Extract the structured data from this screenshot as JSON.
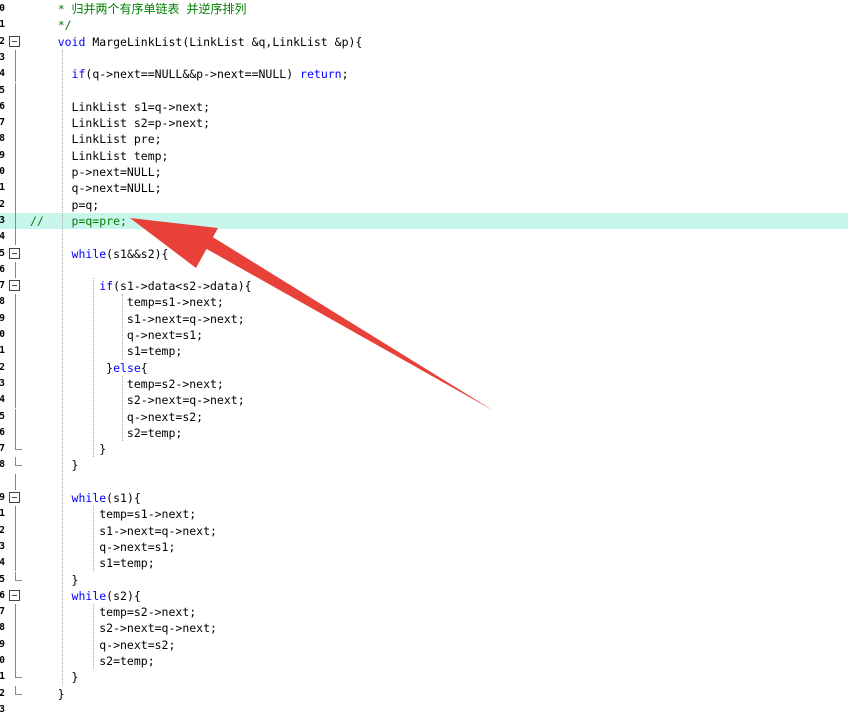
{
  "editor": {
    "lines": [
      {
        "num": "0",
        "text": "    * 归并两个有序单链表 并逆序排列",
        "style": "comment"
      },
      {
        "num": "1",
        "text": "    */",
        "style": "comment"
      },
      {
        "num": "2",
        "text": "    void MargeLinkList(LinkList &q,LinkList &p){",
        "style": "code",
        "fold": "open"
      },
      {
        "num": "3",
        "text": "",
        "style": "code",
        "fold": "mid"
      },
      {
        "num": "4",
        "text": "      if(q->next==NULL&&p->next==NULL) return;",
        "style": "code",
        "fold": "mid"
      },
      {
        "num": "5",
        "text": "",
        "style": "code",
        "fold": "mid"
      },
      {
        "num": "6",
        "text": "      LinkList s1=q->next;",
        "style": "code",
        "fold": "mid"
      },
      {
        "num": "7",
        "text": "      LinkList s2=p->next;",
        "style": "code",
        "fold": "mid"
      },
      {
        "num": "8",
        "text": "      LinkList pre;",
        "style": "code",
        "fold": "mid"
      },
      {
        "num": "9",
        "text": "      LinkList temp;",
        "style": "code",
        "fold": "mid"
      },
      {
        "num": "0",
        "text": "      p->next=NULL;",
        "style": "code",
        "fold": "mid"
      },
      {
        "num": "1",
        "text": "      q->next=NULL;",
        "style": "code",
        "fold": "mid"
      },
      {
        "num": "2",
        "text": "      p=q;",
        "style": "code",
        "fold": "mid"
      },
      {
        "num": "3",
        "text": "//    p=q=pre;",
        "style": "comment",
        "highlight": true,
        "fold": "mid"
      },
      {
        "num": "4",
        "text": "",
        "style": "code",
        "fold": "mid"
      },
      {
        "num": "5",
        "text": "      while(s1&&s2){",
        "style": "code",
        "fold": "open"
      },
      {
        "num": "6",
        "text": "",
        "style": "code",
        "fold": "mid"
      },
      {
        "num": "7",
        "text": "          if(s1->data<s2->data){",
        "style": "code",
        "fold": "open"
      },
      {
        "num": "8",
        "text": "              temp=s1->next;",
        "style": "code",
        "fold": "mid"
      },
      {
        "num": "9",
        "text": "              s1->next=q->next;",
        "style": "code",
        "fold": "mid"
      },
      {
        "num": "0",
        "text": "              q->next=s1;",
        "style": "code",
        "fold": "mid"
      },
      {
        "num": "1",
        "text": "              s1=temp;",
        "style": "code",
        "fold": "mid"
      },
      {
        "num": "2",
        "text": "           }else{",
        "style": "code",
        "fold": "mid"
      },
      {
        "num": "3",
        "text": "              temp=s2->next;",
        "style": "code",
        "fold": "mid"
      },
      {
        "num": "4",
        "text": "              s2->next=q->next;",
        "style": "code",
        "fold": "mid"
      },
      {
        "num": "5",
        "text": "              q->next=s2;",
        "style": "code",
        "fold": "mid"
      },
      {
        "num": "6",
        "text": "              s2=temp;",
        "style": "code",
        "fold": "mid"
      },
      {
        "num": "7",
        "text": "          }",
        "style": "code",
        "fold": "end"
      },
      {
        "num": "8",
        "text": "      }",
        "style": "code",
        "fold": "end"
      },
      {
        "num": "",
        "text": "",
        "style": "code",
        "fold": "mid"
      },
      {
        "num": "9",
        "text": "      while(s1){",
        "style": "code",
        "fold": "open"
      },
      {
        "num": "1",
        "text": "          temp=s1->next;",
        "style": "code",
        "fold": "mid"
      },
      {
        "num": "2",
        "text": "          s1->next=q->next;",
        "style": "code",
        "fold": "mid"
      },
      {
        "num": "3",
        "text": "          q->next=s1;",
        "style": "code",
        "fold": "mid"
      },
      {
        "num": "4",
        "text": "          s1=temp;",
        "style": "code",
        "fold": "mid"
      },
      {
        "num": "5",
        "text": "      }",
        "style": "code",
        "fold": "end"
      },
      {
        "num": "6",
        "text": "      while(s2){",
        "style": "code",
        "fold": "open"
      },
      {
        "num": "7",
        "text": "          temp=s2->next;",
        "style": "code",
        "fold": "mid"
      },
      {
        "num": "8",
        "text": "          s2->next=q->next;",
        "style": "code",
        "fold": "mid"
      },
      {
        "num": "9",
        "text": "          q->next=s2;",
        "style": "code",
        "fold": "mid"
      },
      {
        "num": "0",
        "text": "          s2=temp;",
        "style": "code",
        "fold": "mid"
      },
      {
        "num": "1",
        "text": "      }",
        "style": "code",
        "fold": "end"
      },
      {
        "num": "2",
        "text": "    }",
        "style": "code",
        "fold": "end"
      },
      {
        "num": "3",
        "text": "",
        "style": "code"
      }
    ]
  },
  "colors": {
    "comment": "#008000",
    "keyword": "#0000ff",
    "highlight": "#c8f5ec",
    "arrow": "#e8413a"
  },
  "annotation": {
    "icon": "red-arrow-icon"
  }
}
